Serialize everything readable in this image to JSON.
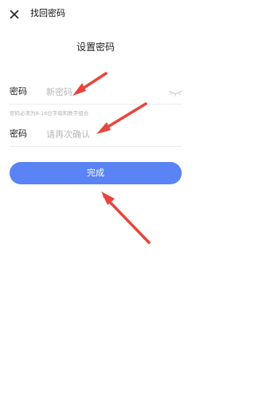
{
  "header": {
    "title": "找回密码",
    "close_icon": "close-icon"
  },
  "page": {
    "title": "设置密码"
  },
  "form": {
    "new_password": {
      "label": "密码",
      "placeholder": "新密码",
      "value": ""
    },
    "hint": "密码必须为8-16位字母和数字组合",
    "confirm_password": {
      "label": "密码",
      "placeholder": "请再次确认",
      "value": ""
    },
    "eye_icon": "eye-closed-icon"
  },
  "actions": {
    "done_label": "完成"
  },
  "colors": {
    "primary_button": "#5a83f5",
    "annotation_arrow": "#e8453c",
    "placeholder_text": "#b8b8b8"
  }
}
